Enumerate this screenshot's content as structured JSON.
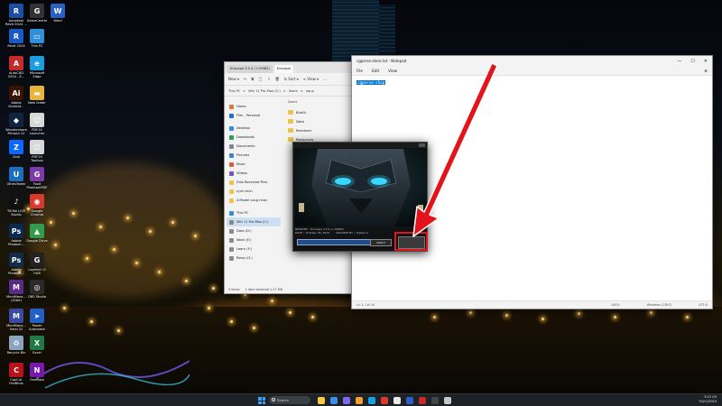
{
  "desktop": {
    "icons": [
      {
        "label": "Autodesk\nRevit 2024 ...",
        "glyph": "R",
        "color": "#1d4fa0"
      },
      {
        "label": "GameCenter",
        "glyph": "G",
        "color": "#333333"
      },
      {
        "label": "Word",
        "glyph": "W",
        "color": "#2b5fc2"
      },
      {
        "label": "Revit 2024",
        "glyph": "R",
        "color": "#1a59c4"
      },
      {
        "label": "This PC",
        "glyph": "▭",
        "color": "#2f8fd8"
      },
      {
        "label": "AutoCAD\n2024 - E...",
        "glyph": "A",
        "color": "#c42b2b"
      },
      {
        "label": "Microsoft\nEdge",
        "glyph": "e",
        "color": "#1b9de2"
      },
      {
        "label": "Adobe\nIllustrat...",
        "glyph": "Ai",
        "color": "#3a1400"
      },
      {
        "label": "New folder",
        "glyph": "▬",
        "color": "#e8b53a"
      },
      {
        "label": "Wondershare\nFilmora 12",
        "glyph": "◆",
        "color": "#11233f"
      },
      {
        "label": "PDF24\nLauncher",
        "glyph": "☺",
        "color": "#d7d7d7"
      },
      {
        "label": "Zalo",
        "glyph": "Z",
        "color": "#0a68ff"
      },
      {
        "label": "PDF24\nToolbox",
        "glyph": "☺",
        "color": "#d7d7d7"
      },
      {
        "label": "UltraViewer",
        "glyph": "U",
        "color": "#1c6fbe"
      },
      {
        "label": "Foxit\nPhantomPDF",
        "glyph": "G",
        "color": "#7d3aa8"
      },
      {
        "label": "TikTok LIVE\nStudio",
        "glyph": "♪",
        "color": "#111111"
      },
      {
        "label": "Google\nChrome",
        "glyph": "◉",
        "color": "#d93a2b"
      },
      {
        "label": "Adobe\nPhotosh...",
        "glyph": "Ps",
        "color": "#0a2a4f"
      },
      {
        "label": "Google Drive",
        "glyph": "▲",
        "color": "#2e9d4c"
      },
      {
        "label": "Adobe\nPhotosh...",
        "glyph": "Ps",
        "color": "#102c4a"
      },
      {
        "label": "Logitech G\nHUB",
        "glyph": "G",
        "color": "#222222"
      },
      {
        "label": "MindMana...\n(32bit)",
        "glyph": "M",
        "color": "#5b2a86"
      },
      {
        "label": "OBS Studio",
        "glyph": "◎",
        "color": "#2a2a2a"
      },
      {
        "label": "MindMana...\nSmai 22",
        "glyph": "M",
        "color": "#3a4aa0"
      },
      {
        "label": "Power\nAutomate",
        "glyph": "➤",
        "color": "#1f5fc7"
      },
      {
        "label": "Recycle Bin",
        "glyph": "♻",
        "color": "#8aa4c0"
      },
      {
        "label": "Excel",
        "glyph": "X",
        "color": "#1f7a45"
      },
      {
        "label": "CapCut\nFireBirds",
        "glyph": "C",
        "color": "#b8121a"
      },
      {
        "label": "OneNote",
        "glyph": "N",
        "color": "#7719aa"
      }
    ]
  },
  "explorer": {
    "tabs": [
      "Enscape 3.5.4 (+19982)",
      "Enscape"
    ],
    "toolbar": [
      "New ▾",
      "✂",
      "⧉",
      "📋",
      "⇪",
      "🗑",
      "⇅ Sort ▾",
      "≡ View ▾",
      "…"
    ],
    "address": [
      "This PC",
      ">",
      "Win 11 Pro Max (C:)",
      ">",
      "Users",
      ">",
      "nguy"
    ],
    "nav_items": [
      {
        "label": "Home",
        "color": "#e07a3c"
      },
      {
        "label": "Film - Personal",
        "color": "#1f6fd1"
      },
      {
        "label": "Desktop",
        "color": "#2e8fe0"
      },
      {
        "label": "Downloads",
        "color": "#2f9b5e"
      },
      {
        "label": "Documents",
        "color": "#7c8a99"
      },
      {
        "label": "Pictures",
        "color": "#3a86d6"
      },
      {
        "label": "Music",
        "color": "#e05a3c"
      },
      {
        "label": "Videos",
        "color": "#7a4ed3"
      },
      {
        "label": "Zalo Received Files",
        "color": "#f2c244"
      },
      {
        "label": "Lynh trich",
        "color": "#f2c244"
      },
      {
        "label": "3.Model cong nhan",
        "color": "#f2c244"
      },
      {
        "label": "This PC",
        "color": "#2f8fd8"
      },
      {
        "label": "Win 11 Pro Max (C:)",
        "color": "#8a8a8a"
      },
      {
        "label": "Data (D:)",
        "color": "#8a8a8a"
      },
      {
        "label": "Work (E:)",
        "color": "#8a8a8a"
      },
      {
        "label": "Learn (F:)",
        "color": "#8a8a8a"
      },
      {
        "label": "Relax (G:)",
        "color": "#8a8a8a"
      }
    ],
    "list_header": "Name",
    "files": [
      "Bin64",
      "Data",
      "Renderer",
      "Resources"
    ],
    "status": [
      "5 items",
      "1 item selected 1.27 MB"
    ]
  },
  "notepad": {
    "title": "cgperse-store.txt - Notepad",
    "window_buttons": [
      "—",
      "☐",
      "✕"
    ],
    "menu": [
      "File",
      "Edit",
      "View"
    ],
    "content": "cgperse-shop",
    "status": [
      "Ln 1, Col 14",
      "100%",
      "Windows (CRLF)",
      "UTF-8"
    ]
  },
  "keygen": {
    "info_line1": "RELEASE :: Enscape 3.5.4 (+19982)",
    "info_line2": "DATE :: October 05, 2023",
    "cracked_by_label": "CRACKED BY ::",
    "cracked_by": "[t]eam-k",
    "about_label": "ABOUT",
    "patch_label": "PATCH"
  },
  "taskbar": {
    "search_placeholder": "Search",
    "time": "9:12 CH",
    "date": "03/11/2023"
  },
  "colors": {
    "highlight": "#e3131b",
    "accent": "#0078d4"
  }
}
